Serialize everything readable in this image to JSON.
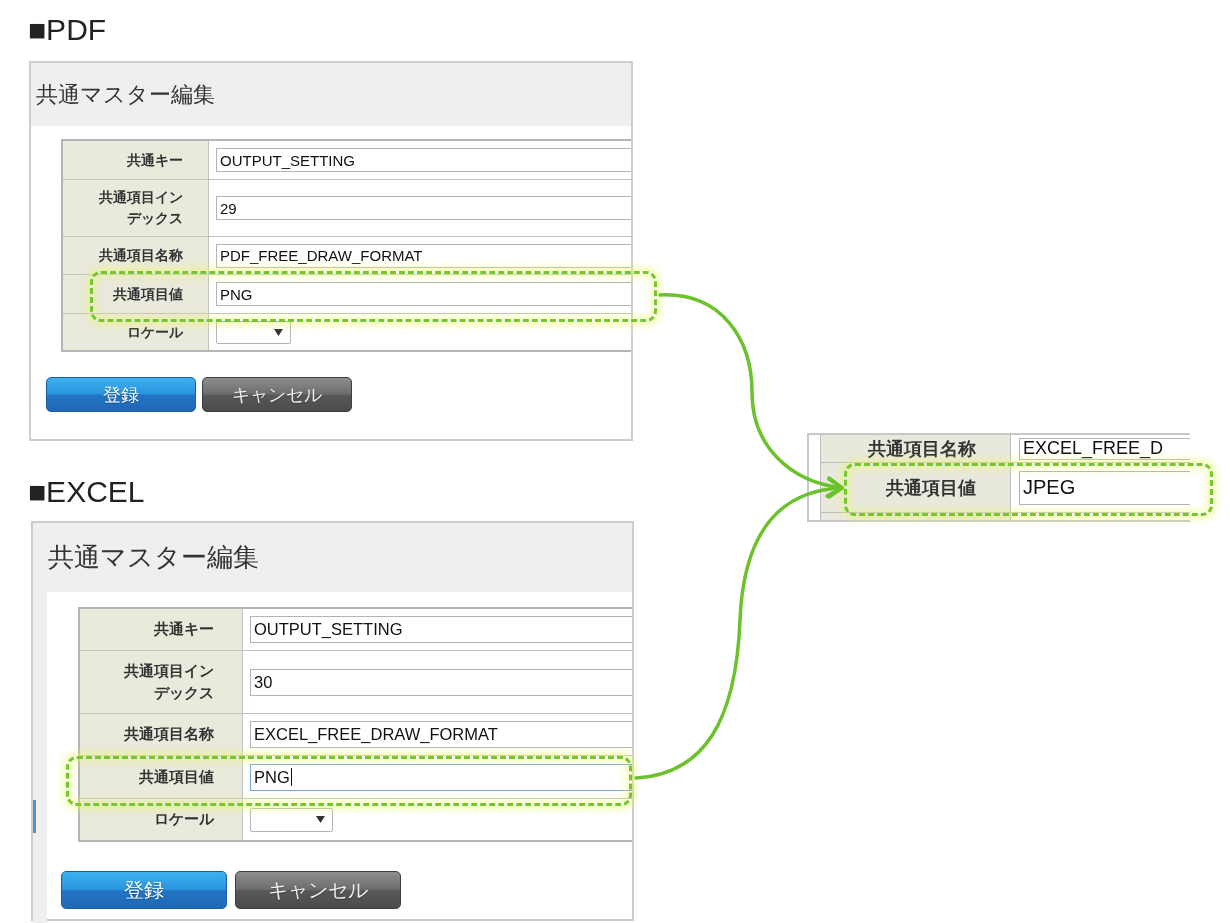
{
  "sections": [
    {
      "heading": "■PDF",
      "panel": {
        "title": "共通マスター編集",
        "rows": [
          {
            "label": "共通キー",
            "kind": "text",
            "value": "OUTPUT_SETTING",
            "highlighted": false,
            "focused": false
          },
          {
            "label": "共通項目インデックス",
            "kind": "text",
            "value": "29",
            "highlighted": false,
            "focused": false
          },
          {
            "label": "共通項目名称",
            "kind": "text",
            "value": "PDF_FREE_DRAW_FORMAT",
            "highlighted": false,
            "focused": false
          },
          {
            "label": "共通項目値",
            "kind": "text",
            "value": "PNG",
            "highlighted": true,
            "focused": false
          },
          {
            "label": "ロケール",
            "kind": "select",
            "highlighted": false,
            "focused": false
          }
        ],
        "buttons": [
          {
            "label": "登録",
            "kind": "primary"
          },
          {
            "label": "キャンセル",
            "kind": "secondary"
          }
        ]
      }
    },
    {
      "heading": "■EXCEL",
      "panel": {
        "title": "共通マスター編集",
        "rows": [
          {
            "label": "共通キー",
            "kind": "text",
            "value": "OUTPUT_SETTING",
            "highlighted": false,
            "focused": false
          },
          {
            "label": "共通項目インデックス",
            "kind": "text",
            "value": "30",
            "highlighted": false,
            "focused": false
          },
          {
            "label": "共通項目名称",
            "kind": "text",
            "value": "EXCEL_FREE_DRAW_FORMAT",
            "highlighted": false,
            "focused": false
          },
          {
            "label": "共通項目値",
            "kind": "text",
            "value": "PNG",
            "highlighted": true,
            "focused": true
          },
          {
            "label": "ロケール",
            "kind": "select",
            "highlighted": false,
            "focused": false
          }
        ],
        "buttons": [
          {
            "label": "登録",
            "kind": "primary"
          },
          {
            "label": "キャンセル",
            "kind": "secondary"
          }
        ]
      }
    }
  ],
  "callout": {
    "rows": [
      {
        "label": "共通項目名称",
        "value": "EXCEL_FREE_D",
        "highlighted": false
      },
      {
        "label": "共通項目値",
        "value": "JPEG",
        "highlighted": true
      }
    ]
  }
}
